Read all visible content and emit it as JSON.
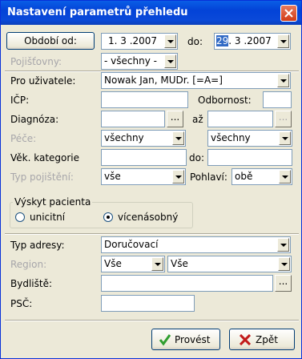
{
  "window": {
    "title": "Nastavení parametrů přehledu"
  },
  "form": {
    "obdobi_od_button": "Období od:",
    "date_from": "1. 3 .2007",
    "do_label": "do:",
    "date_to_day": "29",
    "date_to_rest": ". 3 .2007",
    "pojistovny_label": "Pojišťovny:",
    "pojistovny_value": "- všechny -",
    "pro_uzivatele_label": "Pro uživatele:",
    "pro_uzivatele_value": "Nowak Jan, MUDr. [=A=]",
    "icp_label": "IČP:",
    "icp_value": "",
    "odbornost_label": "Odbornost:",
    "odbornost_value": "",
    "diagnoza_label": "Diagnóza:",
    "diagnoza_from": "",
    "az_label": "až",
    "diagnoza_to": "",
    "browse_label": "...",
    "pece_label": "Péče:",
    "pece_from": "všechny",
    "pece_to": "všechny",
    "vek_label": "Věk. kategorie",
    "vek_from": "",
    "vek_do_label": "do:",
    "vek_to": "",
    "typ_pojisteni_label": "Typ pojištění:",
    "typ_pojisteni_value": "vše",
    "pohlavi_label": "Pohlaví:",
    "pohlavi_value": "obě",
    "vyskyt_title": "Výskyt pacienta",
    "vyskyt_unicitni": "unicitní",
    "vyskyt_vicenasobny": "vícenásobný",
    "typ_adresy_label": "Typ adresy:",
    "typ_adresy_value": "Doručovací",
    "region_label": "Region:",
    "region_value1": "Vše",
    "region_value2": "Vše",
    "bydliste_label": "Bydliště:",
    "bydliste_value": "",
    "psc_label": "PSČ:",
    "psc_value": ""
  },
  "buttons": {
    "ok": "Provést",
    "cancel": "Zpět"
  },
  "colors": {
    "ok_icon": "#2f9e2f",
    "cancel_icon": "#c21a1a",
    "disabled_text": "#a7a6aa"
  }
}
